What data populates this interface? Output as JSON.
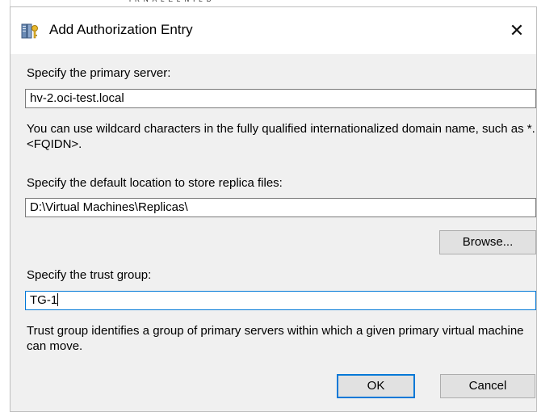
{
  "dialog": {
    "title": "Add Authorization Entry",
    "close_glyph": "✕"
  },
  "primary_server": {
    "label": "Specify the primary server:",
    "value": "hv-2.oci-test.local",
    "note": "You can use wildcard characters in  the fully qualified internationalized domain name, such as *.<FQIDN>."
  },
  "replica_location": {
    "label": "Specify the default location to store replica files:",
    "value": "D:\\Virtual Machines\\Replicas\\"
  },
  "browse_button": "Browse...",
  "trust_group": {
    "label": "Specify the trust group:",
    "value": "TG-1",
    "note": "Trust group identifies a group of primary servers within which a given primary virtual machine can move."
  },
  "buttons": {
    "ok": "OK",
    "cancel": "Cancel"
  },
  "icons": {
    "title_icon": "server-key-icon",
    "close_icon": "close-icon"
  },
  "colors": {
    "accent": "#0078d7",
    "dialog_bg": "#f0f0f0"
  }
}
